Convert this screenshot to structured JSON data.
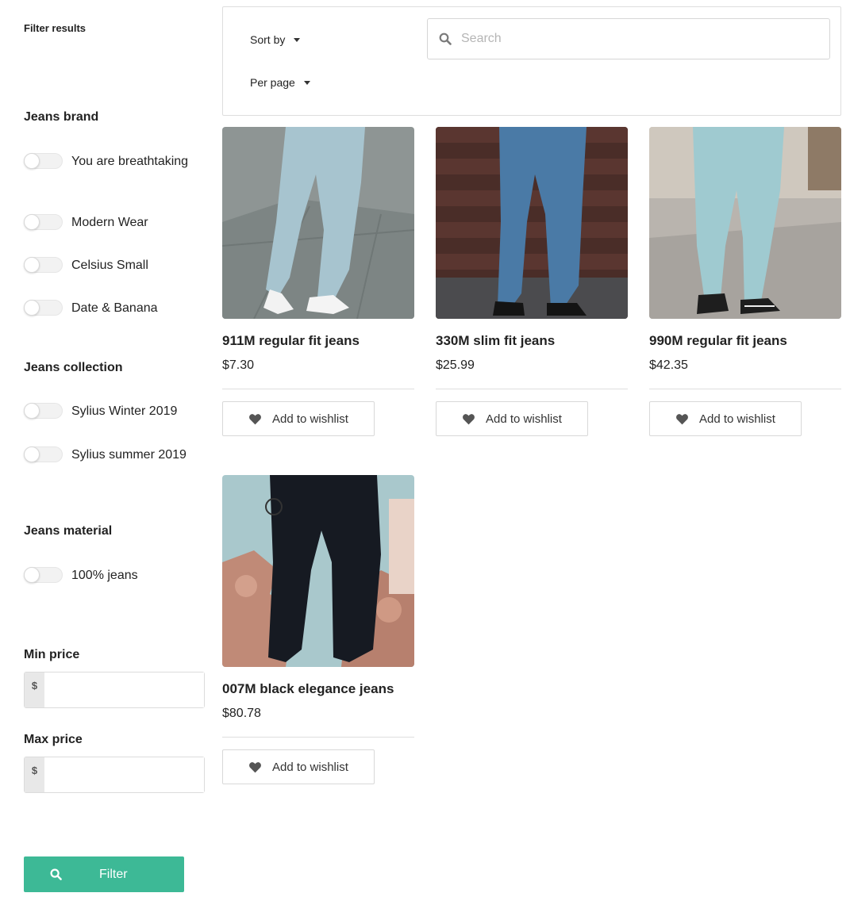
{
  "sidebar": {
    "title": "Filter results",
    "groups": [
      {
        "title": "Jeans brand",
        "options": [
          "You are breathtaking",
          "Modern Wear",
          "Celsius Small",
          "Date & Banana"
        ]
      },
      {
        "title": "Jeans collection",
        "options": [
          "Sylius Winter 2019",
          "Sylius summer 2019"
        ]
      },
      {
        "title": "Jeans material",
        "options": [
          "100% jeans"
        ]
      }
    ],
    "min_price": {
      "label": "Min price",
      "currency": "$",
      "value": ""
    },
    "max_price": {
      "label": "Max price",
      "currency": "$",
      "value": ""
    },
    "filter_button": "Filter"
  },
  "toolbar": {
    "sort_label": "Sort by",
    "per_page_label": "Per page",
    "search_placeholder": "Search"
  },
  "products": [
    {
      "name": "911M regular fit jeans",
      "price": "$7.30",
      "wishlist_label": "Add to wishlist"
    },
    {
      "name": "330M slim fit jeans",
      "price": "$25.99",
      "wishlist_label": "Add to wishlist"
    },
    {
      "name": "990M regular fit jeans",
      "price": "$42.35",
      "wishlist_label": "Add to wishlist"
    },
    {
      "name": "007M black elegance jeans",
      "price": "$80.78",
      "wishlist_label": "Add to wishlist"
    }
  ],
  "icons": {
    "search": "search-icon",
    "heart": "heart-icon",
    "caret": "caret-down-icon"
  },
  "colors": {
    "accent": "#3db996",
    "border": "#dedede",
    "text": "#222222"
  }
}
